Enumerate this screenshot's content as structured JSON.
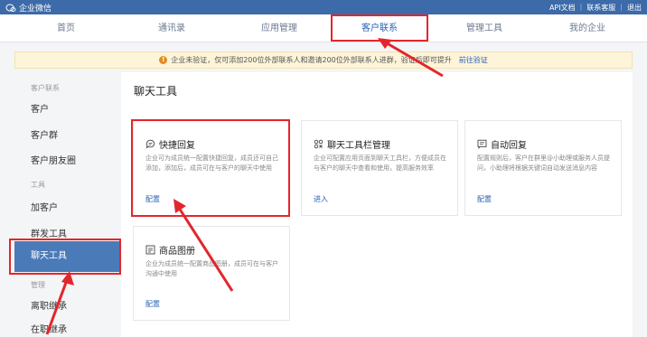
{
  "topbar": {
    "app_name": "企业微信",
    "links": [
      "API文档",
      "联系客服",
      "退出"
    ],
    "bg_color": "#3d6aa8"
  },
  "nav": {
    "items": [
      "首页",
      "通讯录",
      "应用管理",
      "客户联系",
      "管理工具",
      "我的企业"
    ],
    "active_index": 3
  },
  "notice": {
    "text": "企业未验证，仅可添加200位外部联系人和邀请200位外部联系人进群，验证后即可提升",
    "link": "前往验证"
  },
  "sidebar": {
    "groups": [
      {
        "label": "客户联系",
        "items": [
          "客户",
          "客户群",
          "客户朋友圈"
        ]
      },
      {
        "label": "工具",
        "items": [
          "加客户",
          "群发工具",
          "聊天工具"
        ]
      },
      {
        "label": "管理",
        "items": [
          "离职继承",
          "在职继承"
        ]
      }
    ],
    "active_item": "聊天工具"
  },
  "main": {
    "title": "聊天工具",
    "cards": [
      {
        "icon": "chat-bubble-icon",
        "title": "快捷回复",
        "desc": "企业可为成员统一配置快捷回复，成员还可自己添加，添加后，成员可在与客户的聊天中使用",
        "action": "配置"
      },
      {
        "icon": "toolbar-grid-icon",
        "title": "聊天工具栏管理",
        "desc": "企业可配置应用页面到聊天工具栏，方便成员在与客户的聊天中查看和使用，提高服务效率",
        "action": "进入"
      },
      {
        "icon": "auto-reply-icon",
        "title": "自动回复",
        "desc": "配置规则后，客户在群里@小助理或服务人员提问，小助理将根据关键词自动发送消息内容",
        "action": "配置"
      },
      {
        "icon": "album-icon",
        "title": "商品图册",
        "desc": "企业为成员统一配置商品图册，成员可在与客户沟通中使用",
        "action": "配置"
      }
    ]
  },
  "accent_color": "#2a63b5",
  "highlight_color": "#e3262c"
}
